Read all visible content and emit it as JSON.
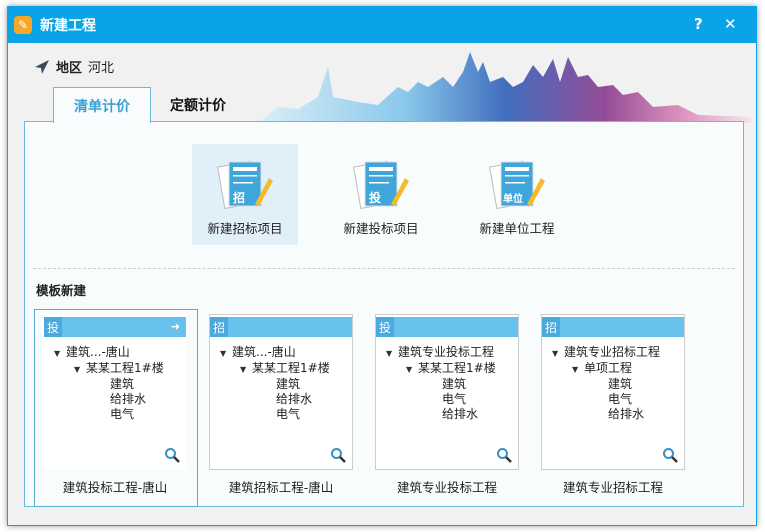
{
  "dialog": {
    "title": "新建工程",
    "help": "?",
    "close": "✕"
  },
  "region": {
    "label": "地区",
    "value": "河北"
  },
  "tabs": [
    {
      "label": "清单计价",
      "active": true
    },
    {
      "label": "定额计价",
      "active": false
    }
  ],
  "actions": [
    {
      "label": "新建招标项目",
      "badge": "招"
    },
    {
      "label": "新建投标项目",
      "badge": "投"
    },
    {
      "label": "新建单位工程",
      "badge": "单位"
    }
  ],
  "template_section": "模板新建",
  "templates": [
    {
      "tag": "投",
      "name": "建筑投标工程-唐山",
      "tree": [
        "建筑...-唐山",
        "某某工程1#楼",
        "建筑",
        "给排水",
        "电气"
      ]
    },
    {
      "tag": "招",
      "name": "建筑招标工程-唐山",
      "tree": [
        "建筑...-唐山",
        "某某工程1#楼",
        "建筑",
        "给排水",
        "电气"
      ]
    },
    {
      "tag": "投",
      "name": "建筑专业投标工程",
      "tree": [
        "建筑专业投标工程",
        "某某工程1#楼",
        "建筑",
        "电气",
        "给排水"
      ]
    },
    {
      "tag": "招",
      "name": "建筑专业招标工程",
      "tree": [
        "建筑专业招标工程",
        "单项工程",
        "建筑",
        "电气",
        "给排水"
      ]
    }
  ],
  "colors": {
    "titlebar": "#0aa3e8",
    "accent": "#3aa0d4"
  }
}
